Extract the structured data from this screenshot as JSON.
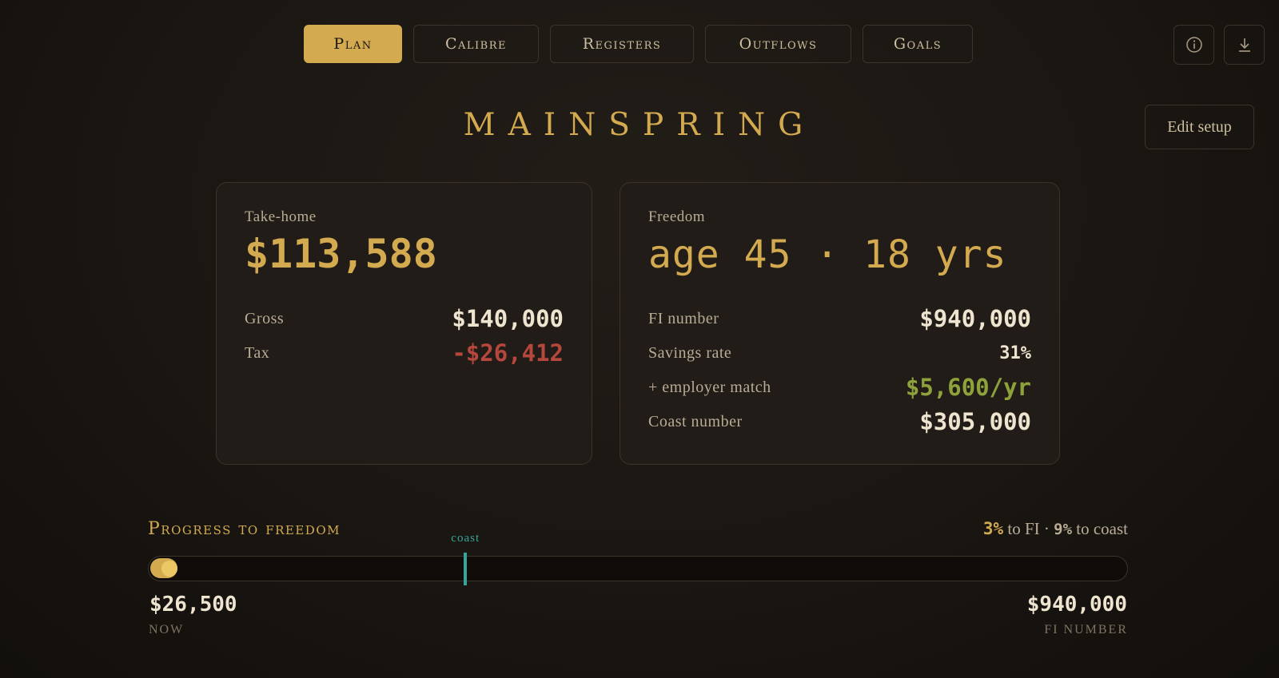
{
  "nav": {
    "tabs": [
      {
        "label": "Plan",
        "active": true
      },
      {
        "label": "Calibre",
        "active": false
      },
      {
        "label": "Registers",
        "active": false
      },
      {
        "label": "Outflows",
        "active": false
      },
      {
        "label": "Goals",
        "active": false
      }
    ],
    "icons": [
      "info-icon",
      "download-icon"
    ]
  },
  "header": {
    "title": "MAINSPRING",
    "edit_label": "Edit setup"
  },
  "takehome": {
    "label": "Take-home",
    "value": "$113,588",
    "gross_label": "Gross",
    "gross_value": "$140,000",
    "tax_label": "Tax",
    "tax_value": "-$26,412"
  },
  "freedom": {
    "label": "Freedom",
    "headline": "age 45 · 18 yrs",
    "fi_label": "FI number",
    "fi_value": "$940,000",
    "savings_label": "Savings rate",
    "savings_value": "31%",
    "match_label": "+ employer match",
    "match_value": "$5,600/yr",
    "coast_label": "Coast number",
    "coast_value": "$305,000"
  },
  "progress": {
    "heading": "Progress to freedom",
    "fi_pct": "3%",
    "fi_text": " to FI · ",
    "coast_pct": "9%",
    "coast_text": " to coast",
    "marker_label": "coast",
    "now_value": "$26,500",
    "now_label": "NOW",
    "fi_value": "$940,000",
    "fi_label": "FI NUMBER",
    "fraction_fi": 0.028,
    "fraction_coast": 0.324
  },
  "colors": {
    "accent": "#d3aa4f",
    "negative": "#b5473c",
    "positive": "#8ea23c",
    "coast": "#3aa39a"
  }
}
